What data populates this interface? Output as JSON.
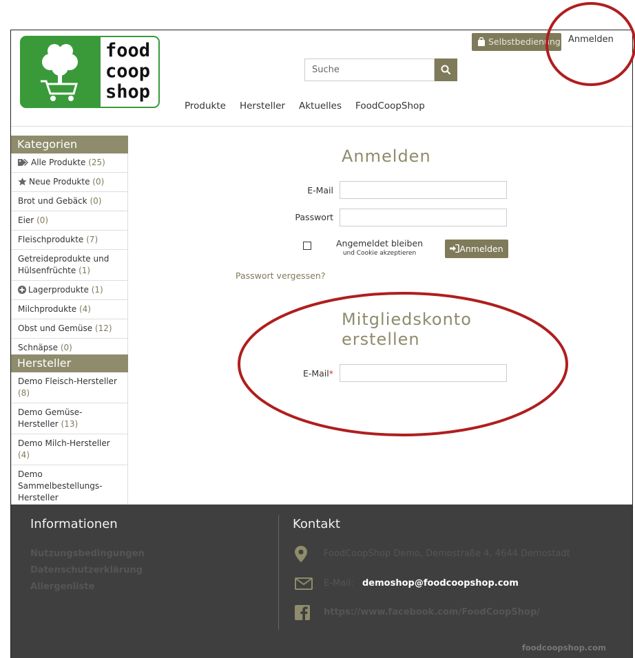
{
  "header": {
    "logo_text": [
      "food",
      "coop",
      "shop"
    ],
    "selfservice_label": "Selbstbedienung",
    "login_link": "Anmelden",
    "search_placeholder": "Suche",
    "nav": [
      "Produkte",
      "Hersteller",
      "Aktuelles",
      "FoodCoopShop"
    ]
  },
  "sidebar": {
    "categories_title": "Kategorien",
    "categories": [
      {
        "label": "Alle Produkte",
        "count": "(25)",
        "icon": "tags-icon"
      },
      {
        "label": "Neue Produkte",
        "count": "(0)",
        "icon": "star-icon"
      },
      {
        "label": "Brot und Gebäck",
        "count": "(0)"
      },
      {
        "label": "Eier",
        "count": "(0)"
      },
      {
        "label": "Fleischprodukte",
        "count": "(7)"
      },
      {
        "label": "Getreideprodukte und Hülsenfrüchte",
        "count": "(1)"
      },
      {
        "label": "Lagerprodukte",
        "count": "(1)",
        "icon": "plus-circle-icon"
      },
      {
        "label": "Milchprodukte",
        "count": "(4)"
      },
      {
        "label": "Obst und Gemüse",
        "count": "(12)"
      },
      {
        "label": "Schnäpse",
        "count": "(0)"
      }
    ],
    "manufacturers_title": "Hersteller",
    "manufacturers": [
      {
        "label": "Demo Fleisch-Hersteller",
        "count": "(8)"
      },
      {
        "label": "Demo Gemüse-Hersteller",
        "count": "(13)"
      },
      {
        "label": "Demo Milch-Hersteller",
        "count": "(4)"
      },
      {
        "label": "Demo Sammelbestellungs-Hersteller",
        "count": ""
      }
    ]
  },
  "login": {
    "title": "Anmelden",
    "email_label": "E-Mail",
    "password_label": "Passwort",
    "remember_label": "Angemeldet bleiben",
    "remember_sub": "und Cookie akzeptieren",
    "button": "Anmelden",
    "forgot": "Passwort vergessen?"
  },
  "register": {
    "title_line1": "Mitgliedskonto",
    "title_line2": "erstellen",
    "email_label": "E-Mail",
    "required_mark": "*"
  },
  "footer": {
    "info_title": "Informationen",
    "links": [
      "Nutzungsbedingungen",
      "Datenschutzerklärung",
      "Allergenliste"
    ],
    "contact_title": "Kontakt",
    "address": "FoodCoopShop Demo, Demostraße 4, 4644 Demostadt",
    "email_prefix": "E-Mail:",
    "email": "demoshop@foodcoopshop.com",
    "facebook": "https://www.facebook.com/FoodCoopShop/",
    "copyright": "foodcoopshop.com"
  },
  "colors": {
    "accent": "#7f7a5a",
    "sidebar_header": "#8e8c6c",
    "logo_green": "#3a9a3a",
    "footer_bg": "#3f3f3f",
    "annotation": "#b01e1e"
  }
}
